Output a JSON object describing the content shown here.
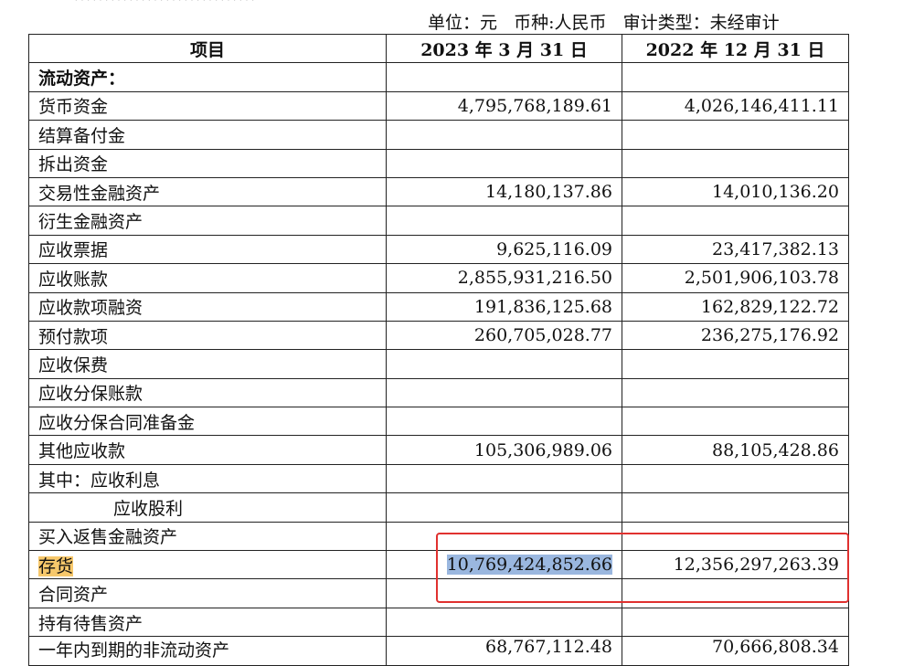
{
  "header": {
    "top_partial": "…………………………",
    "unit_line": "单位：元   币种:人民币   审计类型：未经审计"
  },
  "columns": [
    "项目",
    "2023 年 3 月 31 日",
    "2022 年 12 月 31 日"
  ],
  "rows": [
    {
      "item": "流动资产：",
      "v2023": "",
      "v2022": ""
    },
    {
      "item": "货币资金",
      "v2023": "4,795,768,189.61",
      "v2022": "4,026,146,411.11"
    },
    {
      "item": "结算备付金",
      "v2023": "",
      "v2022": ""
    },
    {
      "item": "拆出资金",
      "v2023": "",
      "v2022": ""
    },
    {
      "item": "交易性金融资产",
      "v2023": "14,180,137.86",
      "v2022": "14,010,136.20"
    },
    {
      "item": "衍生金融资产",
      "v2023": "",
      "v2022": ""
    },
    {
      "item": "应收票据",
      "v2023": "9,625,116.09",
      "v2022": "23,417,382.13"
    },
    {
      "item": "应收账款",
      "v2023": "2,855,931,216.50",
      "v2022": "2,501,906,103.78"
    },
    {
      "item": "应收款项融资",
      "v2023": "191,836,125.68",
      "v2022": "162,829,122.72"
    },
    {
      "item": "预付款项",
      "v2023": "260,705,028.77",
      "v2022": "236,275,176.92"
    },
    {
      "item": "应收保费",
      "v2023": "",
      "v2022": ""
    },
    {
      "item": "应收分保账款",
      "v2023": "",
      "v2022": ""
    },
    {
      "item": "应收分保合同准备金",
      "v2023": "",
      "v2022": ""
    },
    {
      "item": "其他应收款",
      "v2023": "105,306,989.06",
      "v2022": "88,105,428.86"
    },
    {
      "item": "其中：应收利息",
      "v2023": "",
      "v2022": ""
    },
    {
      "item": "应收股利",
      "v2023": "",
      "v2022": ""
    },
    {
      "item": "买入返售金融资产",
      "v2023": "",
      "v2022": ""
    },
    {
      "item": "存货",
      "v2023": "10,769,424,852.66",
      "v2022": "12,356,297,263.39"
    },
    {
      "item": "合同资产",
      "v2023": "",
      "v2022": ""
    },
    {
      "item": "持有待售资产",
      "v2023": "",
      "v2022": ""
    },
    {
      "item": "一年内到期的非流动资产",
      "v2023": "68,767,112.48",
      "v2022": "70,666,808.34"
    }
  ],
  "highlight_color_label": "#f7c86b",
  "highlight_color_value": "#9ab7df",
  "annotation_box_color": "#e0312f"
}
